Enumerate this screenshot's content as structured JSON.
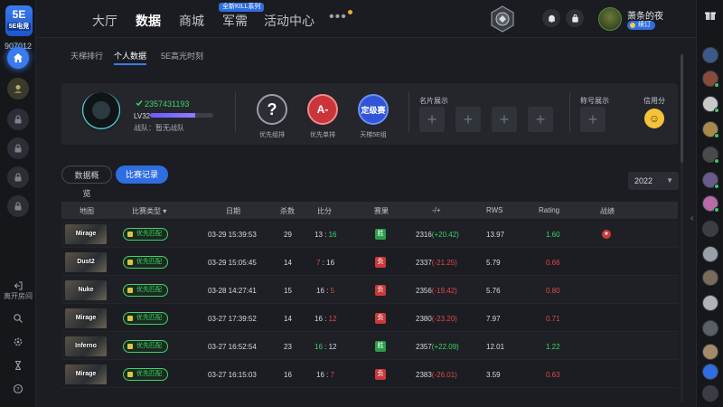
{
  "app": {
    "logo_text": "5E",
    "logo_sub": "5E电竞",
    "user_id": "907012"
  },
  "left_rail": {
    "leave_room_label": "离开房间"
  },
  "nav": {
    "items": [
      "大厅",
      "数据",
      "商城",
      "军需",
      "活动中心"
    ],
    "active": "数据",
    "badge": "全新KILL系列",
    "more": "•••"
  },
  "profile": {
    "name": "萧条的夜",
    "vip": "续订"
  },
  "subtabs": [
    "天梯排行",
    "个人数据",
    "5E高光时刻"
  ],
  "player": {
    "id": "2357431193",
    "level": "LV32",
    "level_progress": 0.72,
    "team": "战队：暂无战队"
  },
  "ranks": [
    {
      "symbol": "?",
      "label": "优先组排"
    },
    {
      "symbol": "A-",
      "label": "优先单排"
    },
    {
      "symbol": "定级赛",
      "label": "天梯5E组"
    }
  ],
  "sections": {
    "card_display": "名片展示",
    "title_display": "称号展示",
    "credit": "信用分",
    "credit_face": "☺"
  },
  "buttons": {
    "overview": "数据概览",
    "records": "比赛记录",
    "year": "2022",
    "year_caret": "▼"
  },
  "table": {
    "headers": [
      "地图",
      "比赛类型",
      "日期",
      "杀数",
      "比分",
      "赛果",
      "-/+",
      "RWS",
      "Rating",
      "战绩"
    ],
    "header_sort": "▾",
    "rows": [
      {
        "map": "Mirage",
        "type": "优先匹配",
        "date": "03-29 15:39:53",
        "kills": "29",
        "score_a": "13",
        "score_sep": " : ",
        "score_b": "16",
        "result": "胜",
        "elo": "2316",
        "delta": "(+20.42)",
        "rws": "13.97",
        "rating": "1.60",
        "win": true,
        "honor": "★"
      },
      {
        "map": "Dust2",
        "type": "优先匹配",
        "date": "03-29 15:05:45",
        "kills": "14",
        "score_a": "7",
        "score_sep": " : ",
        "score_b": "16",
        "result": "负",
        "elo": "2337",
        "delta": "(-21.25)",
        "rws": "5.79",
        "rating": "0.66",
        "win": false,
        "honor": ""
      },
      {
        "map": "Nuke",
        "type": "优先匹配",
        "date": "03-28 14:27:41",
        "kills": "15",
        "score_a": "16",
        "score_sep": " : ",
        "score_b": "5",
        "result": "负",
        "elo": "2356",
        "delta": "(-19.42)",
        "rws": "5.76",
        "rating": "0.80",
        "win": false,
        "honor": ""
      },
      {
        "map": "Mirage",
        "type": "优先匹配",
        "date": "03-27 17:39:52",
        "kills": "14",
        "score_a": "16",
        "score_sep": " : ",
        "score_b": "12",
        "result": "负",
        "elo": "2380",
        "delta": "(-23.20)",
        "rws": "7.97",
        "rating": "0.71",
        "win": false,
        "honor": ""
      },
      {
        "map": "Inferno",
        "type": "优先匹配",
        "date": "03-27 16:52:54",
        "kills": "23",
        "score_a": "16",
        "score_sep": " : ",
        "score_b": "12",
        "result": "胜",
        "elo": "2357",
        "delta": "(+22.09)",
        "rws": "12.01",
        "rating": "1.22",
        "win": true,
        "honor": ""
      },
      {
        "map": "Mirage",
        "type": "优先匹配",
        "date": "03-27 16:15:03",
        "kills": "16",
        "score_a": "16",
        "score_sep": " : ",
        "score_b": "7",
        "result": "负",
        "elo": "2383",
        "delta": "(-26.01)",
        "rws": "3.59",
        "rating": "0.63",
        "win": false,
        "honor": ""
      }
    ]
  },
  "colors": {
    "accent": "#2f6ee0",
    "win": "#3cd46b",
    "lose": "#e24848"
  }
}
